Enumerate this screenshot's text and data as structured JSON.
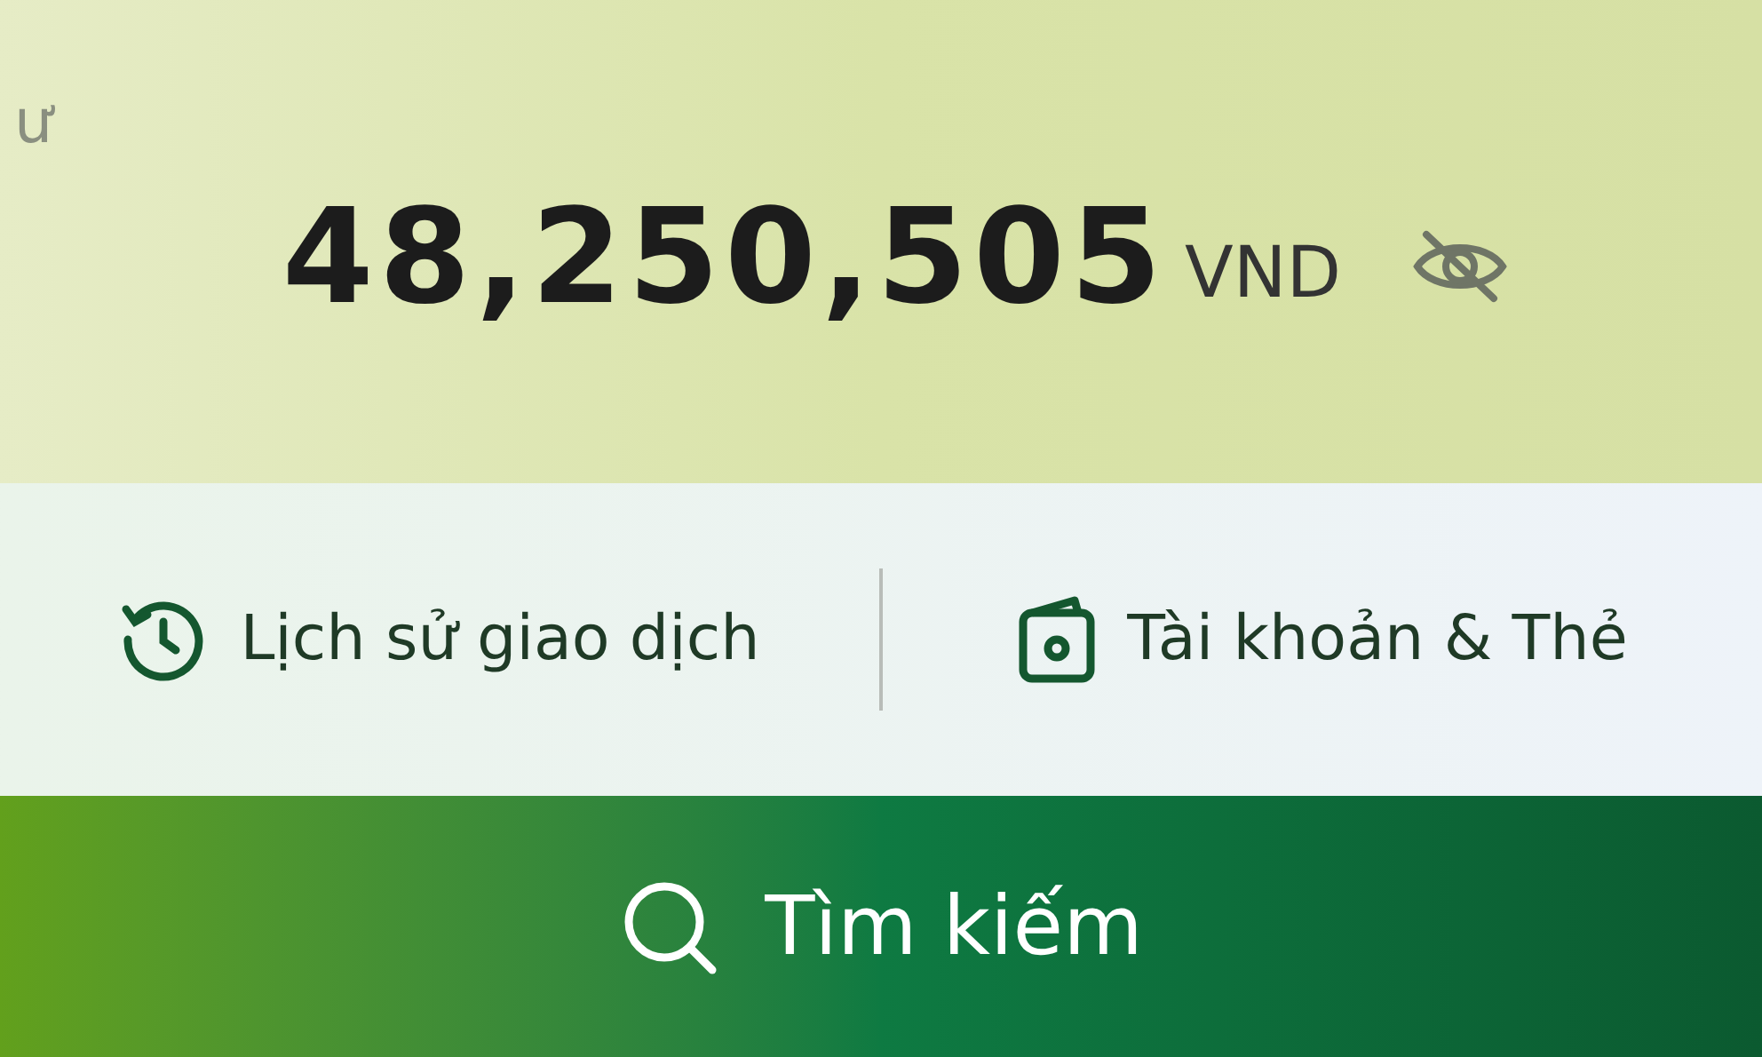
{
  "balance": {
    "label": "ư",
    "amount": "48,250,505",
    "currency": "VND"
  },
  "actions": [
    {
      "kind": "history",
      "label": "Lịch sử giao dịch"
    },
    {
      "kind": "accounts",
      "label": "Tài khoản & Thẻ"
    }
  ],
  "search_button": {
    "label": "Tìm kiếm"
  }
}
